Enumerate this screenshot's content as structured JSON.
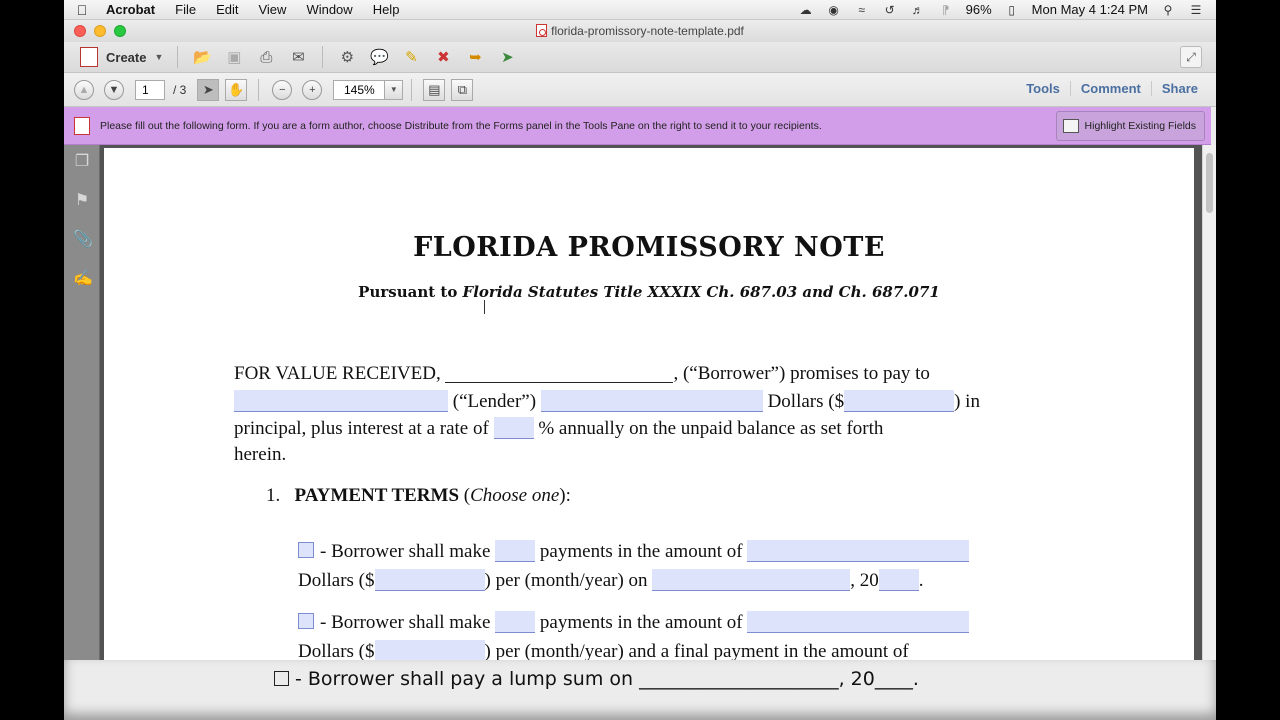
{
  "menubar": {
    "app": "Acrobat",
    "items": [
      "File",
      "Edit",
      "View",
      "Window",
      "Help"
    ],
    "battery": "96%",
    "clock": "Mon May 4  1:24 PM"
  },
  "window": {
    "title": "florida-promissory-note-template.pdf"
  },
  "toolbar": {
    "create_label": "Create"
  },
  "nav": {
    "current_page": "1",
    "page_total": "/  3",
    "zoom": "145%",
    "tabs": [
      "Tools",
      "Comment",
      "Share"
    ]
  },
  "formbar": {
    "message": "Please fill out the following form. If you are a form author, choose Distribute from the Forms panel in the Tools Pane on the right to send it to your recipients.",
    "highlight_label": "Highlight Existing Fields"
  },
  "document": {
    "title": "FLORIDA PROMISSORY NOTE",
    "subtitle_bold": "Pursuant to ",
    "subtitle_italic": "Florida Statutes Title XXXIX Ch. 687.03 and Ch. 687.071",
    "p1_a": "FOR VALUE RECEIVED, ",
    "p1_b": ", (“Borrower”) promises to pay to",
    "p1_c": " (“Lender”) ",
    "p1_d": " Dollars ($",
    "p1_e": ") in",
    "p1_f": "principal, plus interest at a rate of ",
    "p1_g": " % annually on the unpaid balance as set forth",
    "p1_h": "herein.",
    "section_num": "1.",
    "section_title": "PAYMENT TERMS",
    "section_choose": "Choose one",
    "opt1_a": "- Borrower shall make ",
    "opt1_b": " payments in the amount of ",
    "opt1_c": "Dollars ($",
    "opt1_d": ") per (month/year) on ",
    "opt1_e": ", 20",
    "opt1_f": ".",
    "opt2_a": "- Borrower shall make ",
    "opt2_b": " payments in the amount of ",
    "opt2_c": "Dollars ($",
    "opt2_d": ") per (month/year) and a final payment in the amount of"
  },
  "bottom_overlay": {
    "text": "- Borrower shall pay a lump sum on _____________________, 20____."
  }
}
